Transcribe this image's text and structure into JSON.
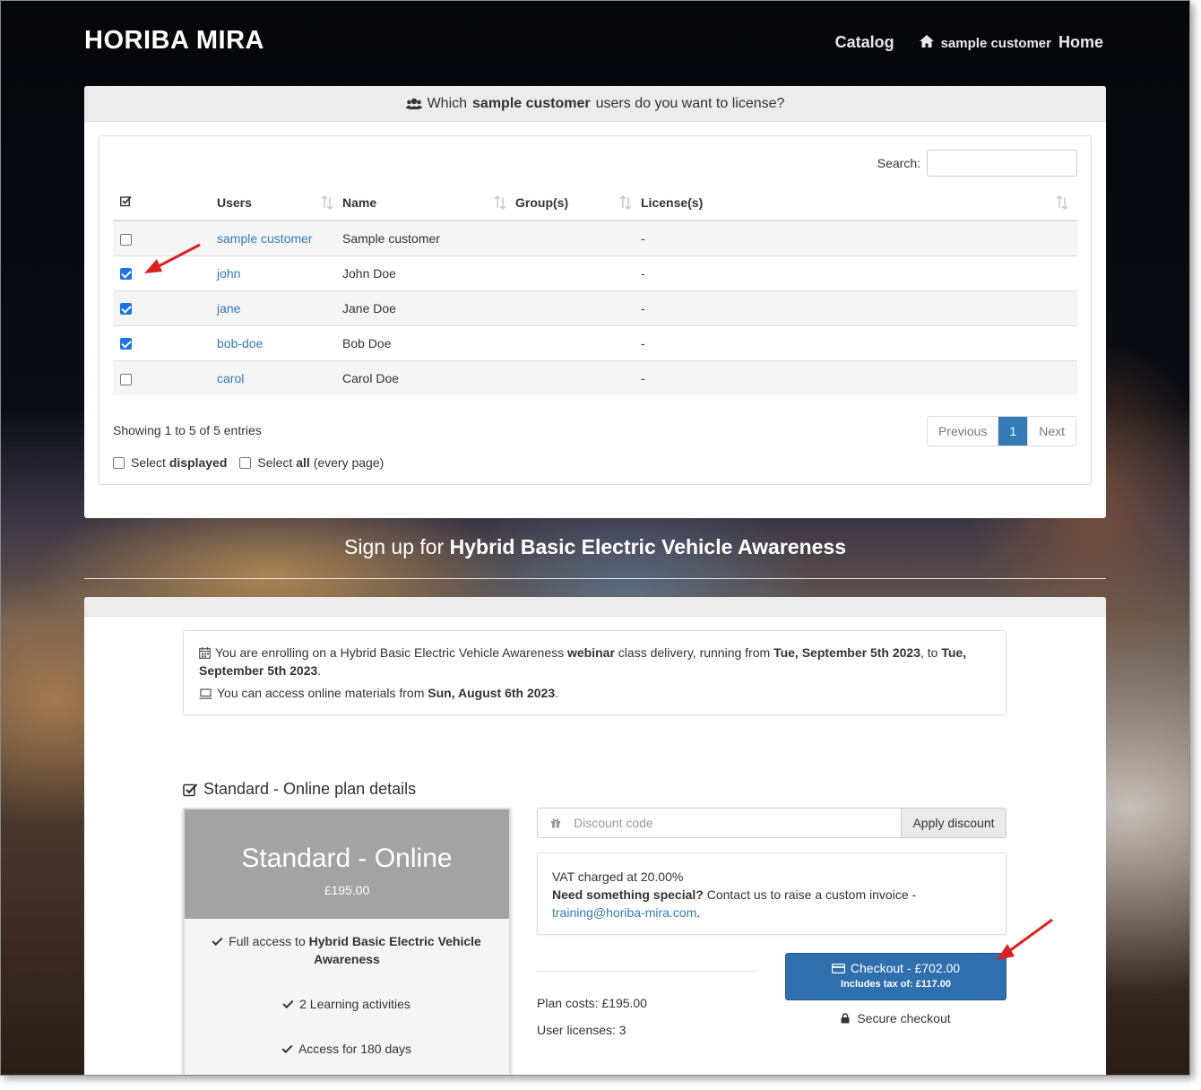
{
  "header": {
    "brand": "HORIBA MIRA",
    "nav_catalog": "Catalog",
    "nav_user": "sample customer",
    "nav_home": "Home"
  },
  "users_panel": {
    "title_pre": "Which",
    "title_bold": "sample customer",
    "title_post": "users do you want to license?",
    "search_label": "Search:",
    "search_value": "",
    "columns": [
      "Users",
      "Name",
      "Group(s)",
      "License(s)"
    ],
    "rows": [
      {
        "user": "sample customer",
        "name": "Sample customer",
        "groups": "",
        "licenses": "-",
        "checked": false
      },
      {
        "user": "john",
        "name": "John Doe",
        "groups": "",
        "licenses": "-",
        "checked": true
      },
      {
        "user": "jane",
        "name": "Jane Doe",
        "groups": "",
        "licenses": "-",
        "checked": true
      },
      {
        "user": "bob-doe",
        "name": "Bob Doe",
        "groups": "",
        "licenses": "-",
        "checked": true
      },
      {
        "user": "carol",
        "name": "Carol Doe",
        "groups": "",
        "licenses": "-",
        "checked": false
      }
    ],
    "showing": "Showing 1 to 5 of 5 entries",
    "pager": {
      "previous": "Previous",
      "current": "1",
      "next": "Next"
    },
    "select_displayed_pre": "Select",
    "select_displayed_bold": "displayed",
    "select_all_pre": "Select",
    "select_all_bold": "all",
    "select_all_post": "(every page)"
  },
  "signup": {
    "pre": "Sign up for",
    "course": "Hybrid Basic Electric Vehicle Awareness"
  },
  "enrol_info": {
    "l1_a": "You are enrolling on a Hybrid Basic Electric Vehicle Awareness",
    "l1_b": "webinar",
    "l1_c": "class delivery, running from",
    "l1_d": "Tue, September 5th 2023",
    "l1_e": ", to",
    "l1_f": "Tue, September 5th 2023",
    "l1_g": ".",
    "l2_a": "You can access online materials from",
    "l2_b": "Sun, August 6th 2023",
    "l2_c": "."
  },
  "plan": {
    "section_title": "Standard - Online plan details",
    "name": "Standard - Online",
    "price": "£195.00",
    "f1_pre": "Full access to",
    "f1_bold": "Hybrid Basic Electric Vehicle Awareness",
    "f2": "2 Learning activities",
    "f3": "Access for 180 days"
  },
  "discount": {
    "placeholder": "Discount code",
    "button": "Apply discount"
  },
  "vat": {
    "line1": "VAT charged at 20.00%",
    "special_bold": "Need something special?",
    "special_text": "Contact us to raise a custom invoice -",
    "email": "training@horiba-mira.com",
    "email_end": "."
  },
  "costs": {
    "plan": "Plan costs: £195.00",
    "licenses": "User licenses: 3"
  },
  "checkout": {
    "label": "Checkout - £702.00",
    "tax_pre": "Includes tax of:",
    "tax_value": "£117.00",
    "secure": "Secure checkout"
  },
  "colors": {
    "link": "#337ab7",
    "checkout_button": "#2f6fad",
    "annotation_arrow": "#e02020"
  }
}
